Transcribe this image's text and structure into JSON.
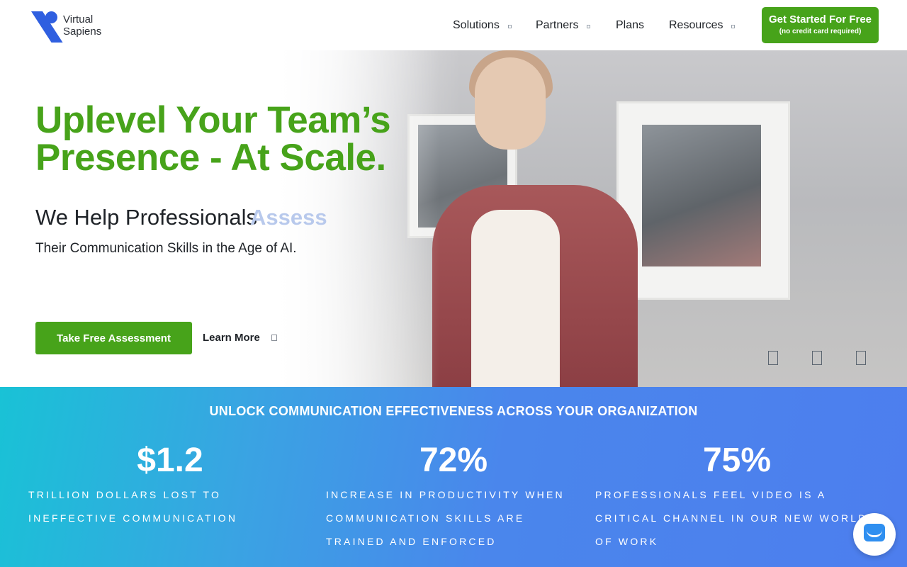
{
  "header": {
    "logo_line1": "Virtual",
    "logo_line2": "Sapiens",
    "nav": [
      {
        "label": "Solutions",
        "has_dropdown": true
      },
      {
        "label": "Partners",
        "has_dropdown": true
      },
      {
        "label": "Plans",
        "has_dropdown": false
      },
      {
        "label": "Resources",
        "has_dropdown": true
      }
    ],
    "cta_label": "Get Started For Free",
    "cta_sublabel": "(no credit card required)"
  },
  "hero": {
    "title_line1": "Uplevel Your Team’s",
    "title_line2": "Presence - At Scale.",
    "subtitle": "We Help Professionals",
    "rotating_word": "Assess",
    "description": "Their Communication Skills in the Age of AI.",
    "primary_button": "Take Free Assessment",
    "secondary_link": "Learn More",
    "video_controls": [
      "prev-icon",
      "pause-icon",
      "next-icon"
    ]
  },
  "stats": {
    "heading": "UNLOCK COMMUNICATION EFFECTIVENESS ACROSS YOUR ORGANIZATION",
    "items": [
      {
        "value": "$1.2",
        "label": "TRILLION DOLLARS LOST TO INEFFECTIVE COMMUNICATION"
      },
      {
        "value": "72%",
        "label": "INCREASE IN PRODUCTIVITY WHEN COMMUNICATION SKILLS ARE TRAINED AND ENFORCED"
      },
      {
        "value": "75%",
        "label": "PROFESSIONALS FEEL VIDEO IS A CRITICAL CHANNEL IN OUR NEW WORLD OF WORK"
      }
    ]
  },
  "colors": {
    "brand_green": "#47a31a",
    "brand_blue": "#2f5fe0",
    "band_start": "#19c2d6",
    "band_end": "#4d7eee"
  },
  "chat_widget": {
    "icon": "chat-bubble-icon"
  }
}
